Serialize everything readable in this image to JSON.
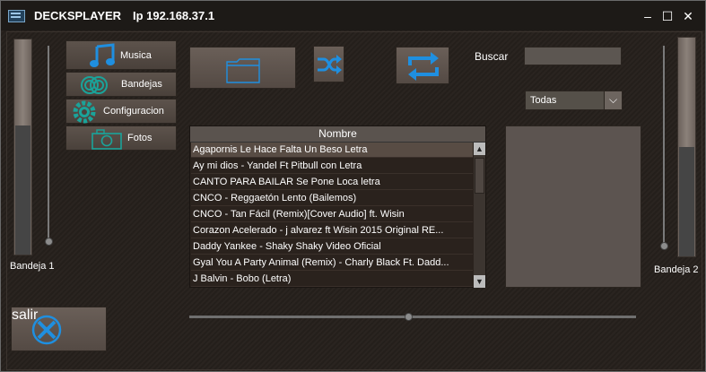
{
  "titlebar": {
    "app_name": "DECKSPLAYER",
    "ip_label": "Ip 192.168.37.1",
    "minimize_glyph": "–",
    "maximize_glyph": "☐",
    "close_glyph": "✕"
  },
  "deck_left": {
    "label": "Bandeja 1",
    "level": 0.6
  },
  "deck_right": {
    "label": "Bandeja 2",
    "level": 0.6
  },
  "nav": {
    "items": [
      {
        "label": "Musica",
        "icon": "music-note-icon"
      },
      {
        "label": "Bandejas",
        "icon": "spiral-icon"
      },
      {
        "label": "Configuracion",
        "icon": "gear-icon"
      },
      {
        "label": "Fotos",
        "icon": "camera-icon"
      }
    ]
  },
  "toolbar": {
    "folder_icon": "folder-icon",
    "shuffle_icon": "shuffle-icon",
    "repeat_icon": "repeat-icon"
  },
  "search": {
    "label": "Buscar",
    "value": ""
  },
  "filter": {
    "selected": "Todas",
    "arrow": "⌵"
  },
  "songs": {
    "header": "Nombre",
    "items": [
      "Agapornis Le Hace Falta Un Beso Letra",
      "Ay mi dios - Yandel Ft Pitbull con Letra",
      "CANTO PARA BAILAR Se Pone Loca letra",
      "CNCO - Reggaetón Lento (Bailemos)",
      "CNCO - Tan Fácil (Remix)[Cover Audio] ft. Wisin",
      "Corazon Acelerado - j alvarez ft  Wisin  2015  Original  RE...",
      "Daddy Yankee - Shaky Shaky  Video Oficial",
      "Gyal You A Party Animal (Remix) - Charly Black Ft. Dadd...",
      "J Balvin - Bobo (Letra)"
    ],
    "selected_index": 0
  },
  "exit": {
    "label": "salir",
    "icon": "close-circle-icon"
  },
  "progress": {
    "position": 0.49
  },
  "colors": {
    "accent": "#1f8fe0",
    "teal": "#1aa39a"
  }
}
